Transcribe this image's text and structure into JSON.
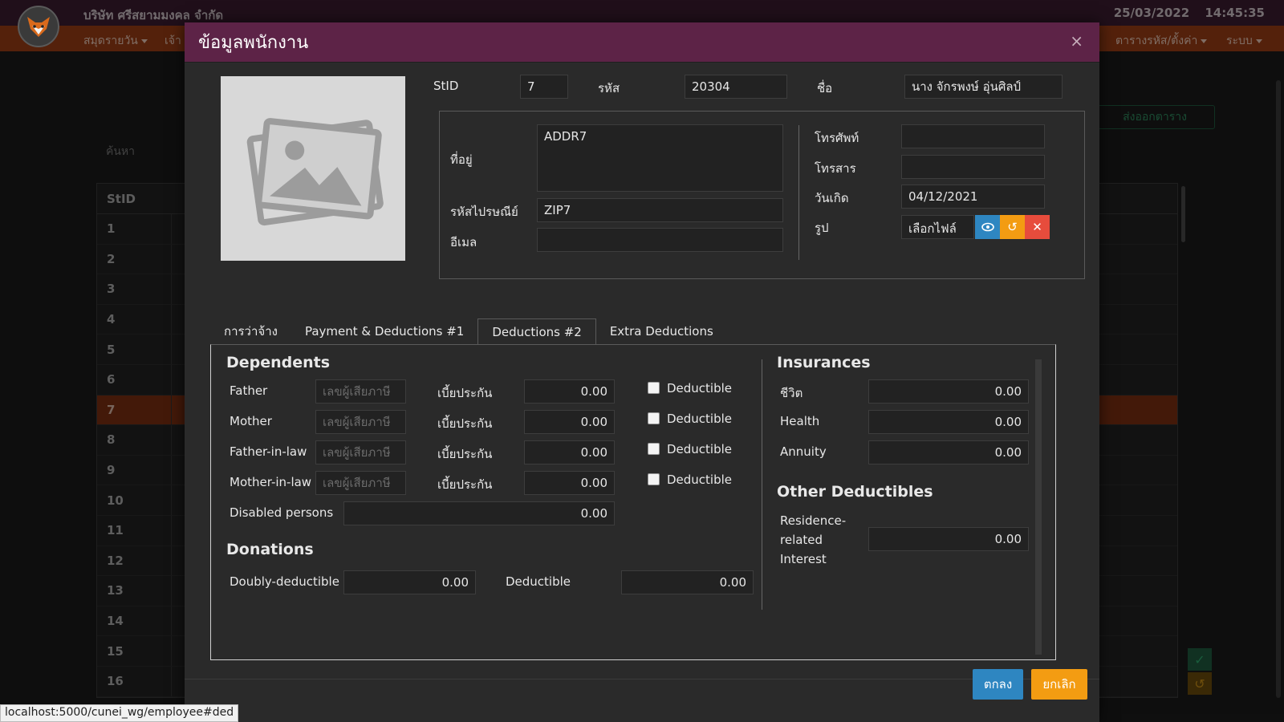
{
  "app": {
    "company": "บริษัท ศรีสยามมงคล จำกัด",
    "date": "25/03/2022",
    "time": "14:45:35",
    "menu_left": [
      "สมุดรายวัน",
      "เจ้า"
    ],
    "menu_right": [
      "ตารางรหัส/ตั้งค่า",
      "ระบบ"
    ],
    "search_label": "ค้นหา",
    "export_label": "ส่งออกตาราง",
    "table_header": "StID",
    "rows": [
      "1",
      "2",
      "3",
      "4",
      "5",
      "6",
      "7",
      "8",
      "9",
      "10",
      "11",
      "12",
      "13",
      "14",
      "15",
      "16"
    ],
    "selected_row": "7"
  },
  "modal": {
    "title": "ข้อมูลพนักงาน",
    "close_icon": "×",
    "stid_label": "StID",
    "stid_value": "7",
    "code_label": "รหัส",
    "code_value": "20304",
    "name_label": "ชื่อ",
    "name_value": "นาง จักรพงษ์ อุ่นศิลป์",
    "address_label": "ที่อยู่",
    "address_value": "ADDR7",
    "zip_label": "รหัสไปรษณีย์",
    "zip_value": "ZIP7",
    "email_label": "อีเมล",
    "email_value": "",
    "phone_label": "โทรศัพท์",
    "phone_value": "",
    "fax_label": "โทรสาร",
    "fax_value": "",
    "birthday_label": "วันเกิด",
    "birthday_value": "04/12/2021",
    "photo_label": "รูป",
    "file_button": "เลือกไฟล์"
  },
  "tabs": [
    {
      "label": "การว่าจ้าง"
    },
    {
      "label": "Payment & Deductions #1"
    },
    {
      "label": "Deductions #2"
    },
    {
      "label": "Extra Deductions"
    }
  ],
  "deductions": {
    "dependents_title": "Dependents",
    "tax_id_placeholder": "เลขผู้เสียภาษี",
    "premium_label": "เบี้ยประกัน",
    "deductible_label": "Deductible",
    "dependents": [
      {
        "label": "Father",
        "premium": "0.00"
      },
      {
        "label": "Mother",
        "premium": "0.00"
      },
      {
        "label": "Father-in-law",
        "premium": "0.00"
      },
      {
        "label": "Mother-in-law",
        "premium": "0.00"
      }
    ],
    "disabled_label": "Disabled persons",
    "disabled_value": "0.00",
    "donations_title": "Donations",
    "doubly_label": "Doubly-deductible",
    "doubly_value": "0.00",
    "deductible_donation_label": "Deductible",
    "deductible_donation_value": "0.00",
    "insurances_title": "Insurances",
    "insurances": [
      {
        "label": "ชีวิต",
        "value": "0.00"
      },
      {
        "label": "Health",
        "value": "0.00"
      },
      {
        "label": "Annuity",
        "value": "0.00"
      }
    ],
    "other_title": "Other Deductibles",
    "residence_label_1": "Residence-",
    "residence_label_2": "related",
    "residence_label_3": "Interest",
    "residence_value": "0.00"
  },
  "footer": {
    "ok_label": "ตกลง",
    "cancel_label": "ยกเลิก"
  },
  "status_url": "localhost:5000/cunei_wg/employee#ded",
  "colors": {
    "header": "#5d2347",
    "nav": "#9a3d14",
    "ok": "#2e86c1",
    "cancel": "#f39c12",
    "view_button": "#2e86c1",
    "reset_button": "#f39c12",
    "delete_button": "#e74c3c"
  }
}
